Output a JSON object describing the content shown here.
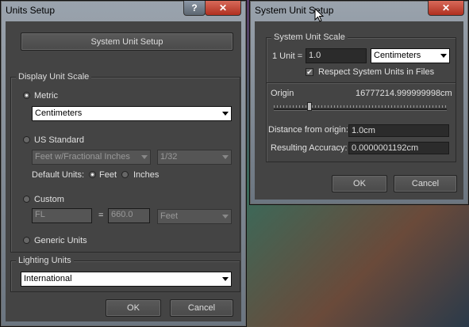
{
  "units_setup": {
    "title": "Units Setup",
    "help_label": "?",
    "close_label": "✕",
    "system_unit_setup_button": "System Unit Setup",
    "display_group_label": "Display Unit Scale",
    "metric_label": "Metric",
    "metric_value": "Centimeters",
    "us_standard_label": "US Standard",
    "us_value": "Feet w/Fractional Inches",
    "us_fraction": "1/32",
    "default_units_label": "Default Units:",
    "feet_label": "Feet",
    "inches_label": "Inches",
    "custom_label": "Custom",
    "custom_name": "FL",
    "custom_equals": "=",
    "custom_value": "660.0",
    "custom_unit": "Feet",
    "generic_units_label": "Generic Units",
    "lighting_group_label": "Lighting Units",
    "lighting_value": "International",
    "ok_label": "OK",
    "cancel_label": "Cancel"
  },
  "system_unit_setup": {
    "title": "System Unit Setup",
    "close_label": "✕",
    "scale_group_label": "System Unit Scale",
    "unit_label": "1 Unit =",
    "unit_value": "1.0",
    "unit_type": "Centimeters",
    "respect_label": "Respect System Units in Files",
    "respect_checked": true,
    "origin_label": "Origin",
    "origin_value": "16777214.999999998cm",
    "origin_slider_level": 0.2,
    "distance_label": "Distance from origin:",
    "distance_value": "1.0cm",
    "accuracy_label": "Resulting Accuracy:",
    "accuracy_value": "0.0000001192cm",
    "ok_label": "OK",
    "cancel_label": "Cancel"
  }
}
